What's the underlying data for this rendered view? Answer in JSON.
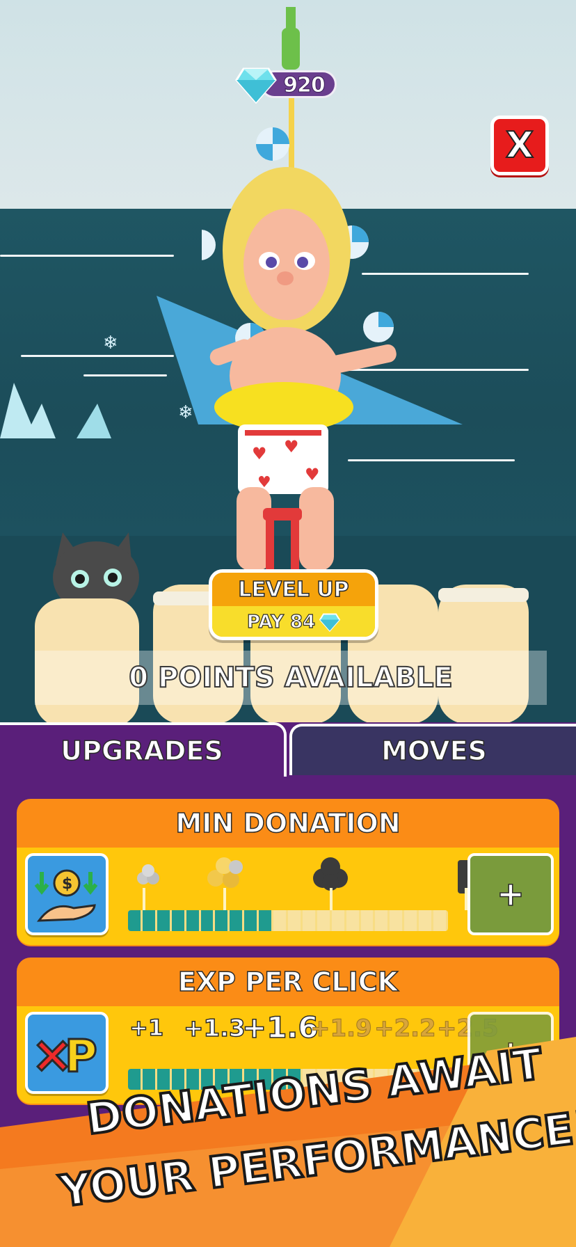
{
  "hud": {
    "gem_count": "920",
    "close_label": "X"
  },
  "level_up": {
    "title": "LEVEL UP",
    "pay_label": "PAY 84"
  },
  "points_available": "0 POINTS AVAILABLE",
  "tabs": [
    {
      "label": "UPGRADES",
      "active": true
    },
    {
      "label": "MOVES",
      "active": false
    }
  ],
  "upgrades": {
    "min_donation": {
      "title": "MIN DONATION",
      "plus_label": "+",
      "progress": 0.45
    },
    "exp_per_click": {
      "title": "EXP PER CLICK",
      "plus_label": "+",
      "progress": 0.55,
      "steps": [
        "+1",
        "+1.3",
        "+1.6",
        "+1.9",
        "+2.2",
        "+2.5"
      ]
    }
  },
  "promo": {
    "line1": "DONATIONS AWAIT",
    "line2": "YOUR PERFORMANCE!"
  },
  "colors": {
    "panel": "#5a1f7a",
    "card_header": "#fb8c16",
    "card_body": "#ffc70c",
    "progress_fill": "#1f9b8f",
    "plus_button": "#7a9b3c",
    "close_button": "#e71c1c",
    "promo_orange": "#f47a1f"
  },
  "icons": [
    "diamond-gem-icon",
    "close-icon",
    "donation-hand-coin-icon",
    "xp-icon",
    "plus-icon",
    "coins-icon"
  ]
}
